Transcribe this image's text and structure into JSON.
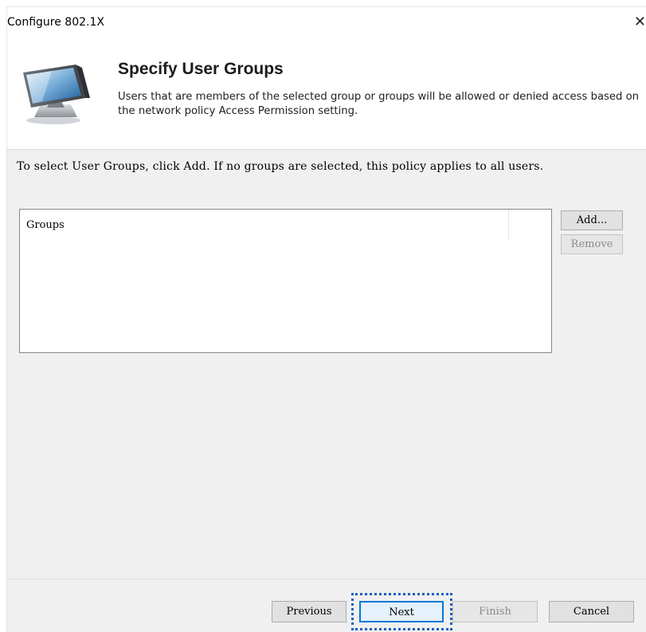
{
  "window": {
    "title": "Configure 802.1X",
    "close_glyph": "✕"
  },
  "header": {
    "title": "Specify User Groups",
    "description": "Users that are members of the selected group or groups will be allowed or denied access based on the network policy Access Permission setting.",
    "icon": "computer-monitor-icon"
  },
  "main": {
    "instruction": "To select User Groups, click Add. If no groups are selected, this policy applies to all users.",
    "groups_list": {
      "column_header": "Groups",
      "items": []
    },
    "add_label": "Add...",
    "remove_label": "Remove"
  },
  "footer": {
    "previous_label": "Previous",
    "next_label": "Next",
    "finish_label": "Finish",
    "cancel_label": "Cancel"
  },
  "colors": {
    "accent": "#0078d7",
    "focus_highlight": "#1a5fbf",
    "panel_background": "#f0f0f0"
  }
}
